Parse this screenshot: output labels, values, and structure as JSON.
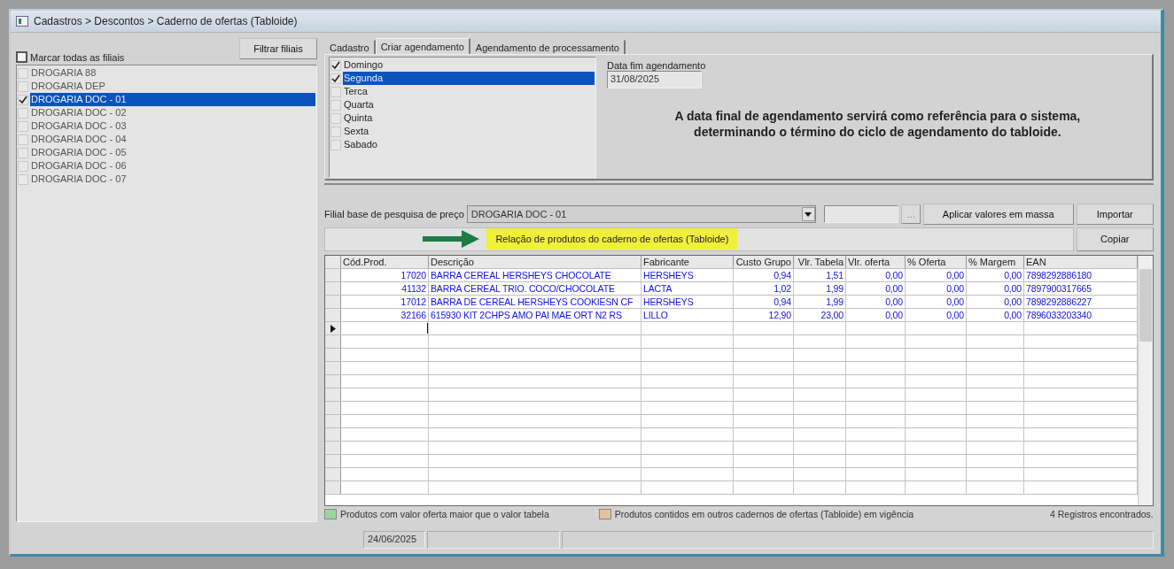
{
  "window": {
    "title": "Cadastros > Descontos > Caderno de ofertas (Tabloide)"
  },
  "branches": {
    "select_all": {
      "label": "Marcar todas as filiais",
      "checked": false
    },
    "filter_button": "Filtrar filiais",
    "items": [
      {
        "label": "DROGARIA 88",
        "checked": false,
        "selected": false
      },
      {
        "label": "DROGARIA DEP",
        "checked": false,
        "selected": false
      },
      {
        "label": "DROGARIA DOC - 01",
        "checked": true,
        "selected": true
      },
      {
        "label": "DROGARIA DOC - 02",
        "checked": false,
        "selected": false
      },
      {
        "label": "DROGARIA DOC - 03",
        "checked": false,
        "selected": false
      },
      {
        "label": "DROGARIA DOC - 04",
        "checked": false,
        "selected": false
      },
      {
        "label": "DROGARIA DOC - 05",
        "checked": false,
        "selected": false
      },
      {
        "label": "DROGARIA DOC - 06",
        "checked": false,
        "selected": false
      },
      {
        "label": "DROGARIA DOC - 07",
        "checked": false,
        "selected": false
      }
    ]
  },
  "tabs": [
    {
      "label": "Cadastro",
      "selected": false
    },
    {
      "label": "Criar agendamento",
      "selected": true
    },
    {
      "label": "Agendamento de processamento",
      "selected": false
    }
  ],
  "days": [
    {
      "label": "Domingo",
      "checked": true,
      "selected": false
    },
    {
      "label": "Segunda",
      "checked": true,
      "selected": true
    },
    {
      "label": "Terca",
      "checked": false,
      "selected": false
    },
    {
      "label": "Quarta",
      "checked": false,
      "selected": false
    },
    {
      "label": "Quinta",
      "checked": false,
      "selected": false
    },
    {
      "label": "Sexta",
      "checked": false,
      "selected": false
    },
    {
      "label": "Sabado",
      "checked": false,
      "selected": false
    }
  ],
  "end_date": {
    "label": "Data fim agendamento",
    "value": "31/08/2025"
  },
  "note": "A data final de agendamento servirá como referência para o sistema,\ndeterminando o término do ciclo de agendamento do tabloide.",
  "price_base": {
    "label": "Filial base de pesquisa de preço",
    "value": "DROGARIA DOC - 01",
    "browse_button": "...",
    "apply_button": "Aplicar valores em massa",
    "import_button": "Importar"
  },
  "banner": {
    "text": "Relação de produtos do caderno de ofertas (Tabloide)",
    "copy_button": "Copiar"
  },
  "table": {
    "columns": [
      "Cód.Prod.",
      "Descrição",
      "Fabricante",
      "Custo Grupo",
      "Vlr. Tabela",
      "Vlr. oferta",
      "% Oferta",
      "% Margem",
      "EAN"
    ],
    "rows": [
      {
        "current": false,
        "cells": [
          "17020",
          "BARRA CEREAL HERSHEYS CHOCOLATE",
          "HERSHEYS",
          "0,94",
          "1,51",
          "0,00",
          "0,00",
          "0,00",
          "7898292886180"
        ]
      },
      {
        "current": false,
        "cells": [
          "41132",
          "BARRA CEREAL TRIO. COCO/CHOCOLATE",
          "LACTA",
          "1,02",
          "1,99",
          "0,00",
          "0,00",
          "0,00",
          "7897900317665"
        ]
      },
      {
        "current": false,
        "cells": [
          "17012",
          "BARRA DE CEREAL HERSHEYS COOKIESN CF",
          "HERSHEYS",
          "0,94",
          "1,99",
          "0,00",
          "0,00",
          "0,00",
          "7898292886227"
        ]
      },
      {
        "current": false,
        "cells": [
          "32166",
          "615930 KIT 2CHPS AMO PAI  MAE ORT N2 RS",
          "LILLO",
          "12,90",
          "23,00",
          "0,00",
          "0,00",
          "0,00",
          "7896033203340"
        ]
      }
    ],
    "new_row": {
      "current": true
    }
  },
  "legend": [
    {
      "label": "Produtos com valor oferta maior que o valor tabela",
      "color": "#9ad89a"
    },
    {
      "label": "Produtos contidos em outros cadernos de ofertas (Tabloide) em vigência",
      "color": "#e6c29c"
    }
  ],
  "record_count": "4 Registros encontrados.",
  "status_bar": {
    "date": "24/06/2025"
  }
}
